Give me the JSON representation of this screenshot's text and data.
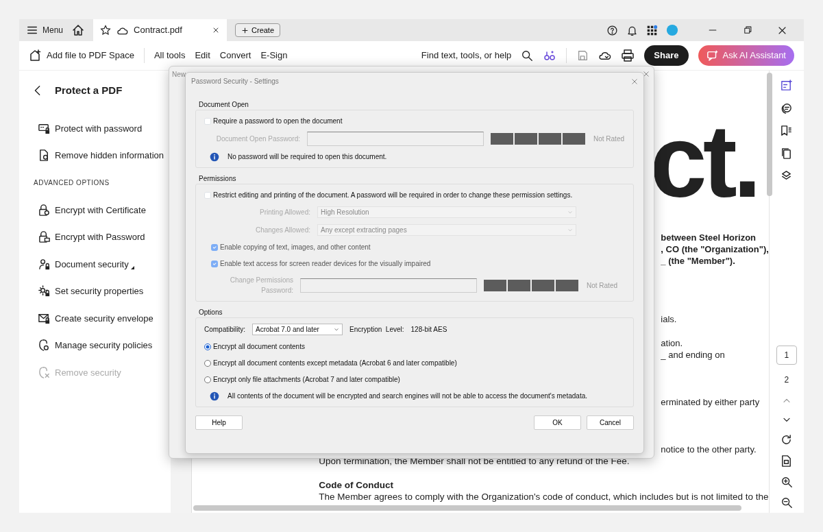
{
  "tab_bar": {
    "menu_label": "Menu",
    "tab": {
      "title": "Contract.pdf",
      "starred": false
    },
    "create_label": "Create"
  },
  "toolbar": {
    "add_file": "Add file to PDF Space",
    "menu": [
      "All tools",
      "Edit",
      "Convert",
      "E-Sign"
    ],
    "search_label": "Find text, tools, or help",
    "share": "Share",
    "ai_assistant": "Ask AI Assistant"
  },
  "side_panel": {
    "title": "Protect a PDF",
    "items": [
      {
        "label": "Protect with password",
        "disabled": false,
        "has_submenu": false
      },
      {
        "label": "Remove hidden information",
        "disabled": false,
        "has_submenu": false
      }
    ],
    "section": "ADVANCED OPTIONS",
    "advanced_items": [
      {
        "label": "Encrypt with Certificate",
        "disabled": false,
        "has_submenu": false
      },
      {
        "label": "Encrypt with Password",
        "disabled": false,
        "has_submenu": false
      },
      {
        "label": "Document security",
        "disabled": false,
        "has_submenu": true
      },
      {
        "label": "Set security properties",
        "disabled": false,
        "has_submenu": false
      },
      {
        "label": "Create security envelope",
        "disabled": false,
        "has_submenu": false
      },
      {
        "label": "Manage security policies",
        "disabled": false,
        "has_submenu": false
      },
      {
        "label": "Remove security",
        "disabled": true,
        "has_submenu": false
      }
    ]
  },
  "document": {
    "title_fragment": "ct.",
    "lines": [
      {
        "kind": "bold",
        "text": "between Steel Horizon"
      },
      {
        "kind": "bold",
        "text": ", CO (the \"Organization\"),"
      },
      {
        "kind": "bold",
        "text": "_ (the \"Member\")."
      },
      {
        "kind": "plain",
        "text": "ials."
      },
      {
        "kind": "plain",
        "text": "ation."
      },
      {
        "kind": "plain",
        "text": "_ and ending on"
      },
      {
        "kind": "plain",
        "text": "erminated by either party"
      },
      {
        "kind": "plain",
        "text": "notice to the other party."
      },
      {
        "kind": "wide",
        "text": "Upon termination, the Member shall not be entitled to any refund of the Fee."
      },
      {
        "kind": "wide_heading",
        "text": "Code of Conduct"
      },
      {
        "kind": "wide",
        "text": "The Member agrees to comply with the Organization's code of conduct, which includes but is not limited to the"
      }
    ]
  },
  "page_nav": {
    "pages": [
      {
        "label": "1",
        "selected": true
      },
      {
        "label": "2",
        "selected": false
      }
    ]
  },
  "outer_dialog": {
    "title": "New"
  },
  "dialog": {
    "title": "Password Security - Settings",
    "document_open": {
      "legend": "Document Open",
      "require": {
        "label": "Require a password to open the document",
        "checked": false
      },
      "password_label": "Document Open Password:",
      "password_disabled": true,
      "rating": "Not Rated",
      "info": "No password will be required to open this document."
    },
    "permissions": {
      "legend": "Permissions",
      "restrict": {
        "label": "Restrict editing and printing of the document. A password will be required in order to change these permission settings.",
        "checked": false
      },
      "selects": [
        {
          "label": "Printing Allowed:",
          "value": "High Resolution",
          "disabled": true
        },
        {
          "label": "Changes Allowed:",
          "value": "Any except extracting pages",
          "disabled": true
        }
      ],
      "checkboxes": [
        {
          "label": "Enable copying of text, images, and other content",
          "checked": true,
          "disabled": true
        },
        {
          "label": "Enable text access for screen reader devices for the visually impaired",
          "checked": true,
          "disabled": true
        }
      ],
      "password_label": "Change Permissions Password:",
      "password_disabled": true,
      "rating": "Not Rated"
    },
    "options": {
      "legend": "Options",
      "compatibility_label": "Compatibility:",
      "compatibility": "Acrobat 7.0 and later",
      "encryption_label": "Encryption  Level:",
      "encryption": "128-bit AES",
      "radios": [
        {
          "label": "Encrypt all document contents",
          "selected": true
        },
        {
          "label": "Encrypt all document contents except metadata (Acrobat 6 and later compatible)",
          "selected": false
        },
        {
          "label": "Encrypt only file attachments (Acrobat 7 and later compatible)",
          "selected": false
        }
      ],
      "info": "All contents of the document will be encrypted and search engines will not be able to access the document's metadata."
    },
    "buttons": {
      "help": "Help",
      "ok": "OK",
      "cancel": "Cancel"
    }
  }
}
